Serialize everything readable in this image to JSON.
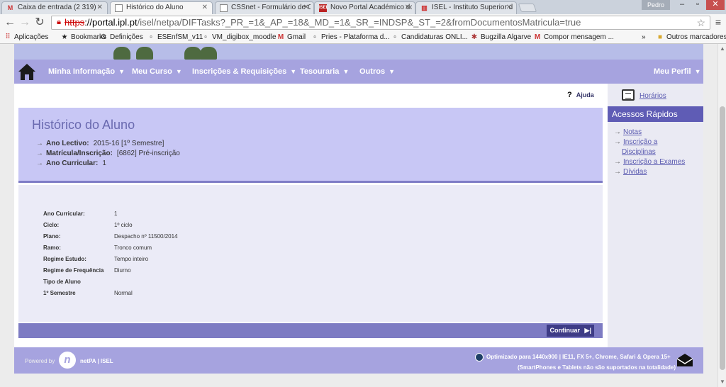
{
  "browser": {
    "tabs": [
      {
        "icon": "gmail-icon",
        "title": "Caixa de entrada (2 319) -",
        "active": false
      },
      {
        "icon": "page-icon",
        "title": "Histórico do Aluno",
        "active": true
      },
      {
        "icon": "page-icon",
        "title": "CSSnet - Formulário de C",
        "active": false
      },
      {
        "icon": "isel-icon",
        "title": "Novo Portal Académico do",
        "active": false
      },
      {
        "icon": "ipl-icon",
        "title": "ISEL - Instituto Superior d",
        "active": false
      }
    ],
    "user": "Pedro",
    "url_scheme": "https",
    "url_host": "://portal.ipl.pt",
    "url_path": "/isel/netpa/DIFTasks?_PR_=1&_AP_=18&_MD_=1&_SR_=INDSP&_ST_=2&fromDocumentosMatricula=true",
    "bookmarks": [
      {
        "icon": "apps-icon",
        "label": "Aplicações"
      },
      {
        "icon": "star-icon",
        "label": "Bookmarks"
      },
      {
        "icon": "gear-icon",
        "label": "Definições"
      },
      {
        "icon": "page-icon",
        "label": "ESEnfSM_v11"
      },
      {
        "icon": "page-icon",
        "label": "VM_digibox_moodle"
      },
      {
        "icon": "gmail-icon",
        "label": "Gmail"
      },
      {
        "icon": "page-icon",
        "label": "Pries - Plataforma d..."
      },
      {
        "icon": "page-icon",
        "label": "Candidaturas ONLI..."
      },
      {
        "icon": "bug-icon",
        "label": "Bugzilla Algarve"
      },
      {
        "icon": "gmail-icon",
        "label": "Compor mensagem ..."
      }
    ],
    "more": "»",
    "other_bookmarks": "Outros marcadores"
  },
  "nav": {
    "items": [
      "Minha Informação",
      "Meu Curso",
      "Inscrições & Requisições",
      "Tesouraria",
      "Outros"
    ],
    "profile": "Meu Perfil"
  },
  "help_label": "Ajuda",
  "header": {
    "title": "Histórico do Aluno",
    "rows": [
      {
        "label": "Ano Lectivo:",
        "value": "2015-16 [1º Semestre]"
      },
      {
        "label": "Matrícula/Inscrição:",
        "value": "[6862] Pré-inscrição"
      },
      {
        "label": "Ano Curricular:",
        "value": "1"
      }
    ]
  },
  "details": [
    {
      "label": "Ano Curricular:",
      "value": "1"
    },
    {
      "label": "Ciclo:",
      "value": "1º ciclo"
    },
    {
      "label": "Plano:",
      "value": "Despacho nº 11500/2014"
    },
    {
      "label": "Ramo:",
      "value": "Tronco comum"
    },
    {
      "label": "Regime Estudo:",
      "value": "Tempo inteiro"
    },
    {
      "label": "Regime de Frequência",
      "value": "Diurno"
    },
    {
      "label": "Tipo de Aluno",
      "value": ""
    },
    {
      "label": "1º Semestre",
      "value": "Normal"
    }
  ],
  "continue_label": "Continuar",
  "sidebar": {
    "schedule_link": "Horários",
    "quick_title": "Acessos Rápidos",
    "quick_links": [
      {
        "lines": [
          "Notas"
        ]
      },
      {
        "lines": [
          "Inscrição a",
          "Disciplinas"
        ]
      },
      {
        "lines": [
          "Inscrição a Exames"
        ]
      },
      {
        "lines": [
          "Dívidas"
        ]
      }
    ]
  },
  "footer": {
    "powered": "Powered by",
    "brand": "netPA | ISEL",
    "optimized": "Optimizado para 1440x900 | IE11, FX 5+, Chrome, Safari & Opera 15+",
    "note": "(SmartPhones e Tablets não são suportados na totalidade)"
  },
  "colors": {
    "nav": "#a6a3df",
    "panel_head": "#c8c7f5",
    "quick_head": "#5f5cb5",
    "button": "#3e3c86"
  }
}
